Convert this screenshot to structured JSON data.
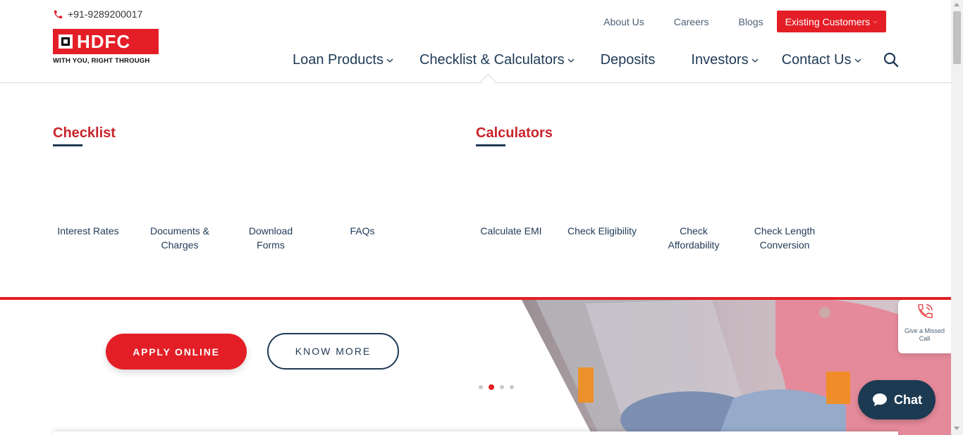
{
  "header": {
    "phone": "+91-9289200017",
    "logo_text": "HDFC",
    "logo_tagline": "WITH YOU, RIGHT THROUGH",
    "top_links": [
      "About Us",
      "Careers",
      "Blogs"
    ],
    "existing_customers": "Existing Customers",
    "nav": [
      {
        "label": "Loan Products",
        "has_dropdown": true
      },
      {
        "label": "Checklist & Calculators",
        "has_dropdown": true
      },
      {
        "label": "Deposits",
        "has_dropdown": false
      },
      {
        "label": "Investors",
        "has_dropdown": true
      },
      {
        "label": "Contact Us",
        "has_dropdown": true
      }
    ],
    "search_icon": "search-icon"
  },
  "dropdown": {
    "checklist": {
      "title": "Checklist",
      "links": [
        "Interest Rates",
        "Documents & Charges",
        "Download Forms",
        "FAQs"
      ]
    },
    "calculators": {
      "title": "Calculators",
      "links": [
        "Calculate EMI",
        "Check Eligibility",
        "Check Affordability",
        "Check Length Conversion"
      ]
    }
  },
  "hero": {
    "apply_label": "APPLY ONLINE",
    "know_more_label": "KNOW MORE",
    "slides_total": 4,
    "active_slide": 2
  },
  "floating": {
    "missed_call": "Give a Missed Call",
    "chat": "Chat"
  },
  "colors": {
    "brand_red": "#e41e26",
    "navy": "#1f3a56",
    "chat_bg": "#1c3a52"
  }
}
